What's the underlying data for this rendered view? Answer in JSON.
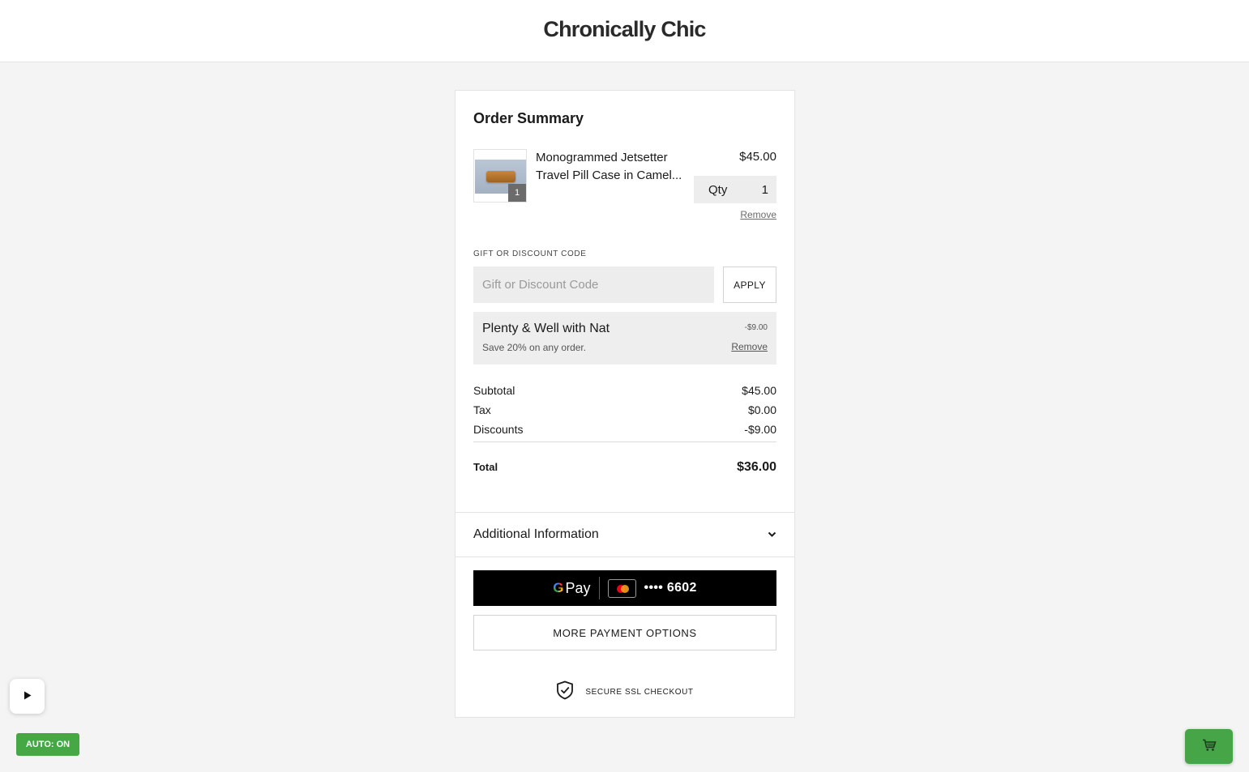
{
  "header": {
    "brand": "Chronically Chic"
  },
  "order_summary": {
    "title": "Order Summary",
    "item": {
      "name_line1": "Monogrammed Jetsetter",
      "name_line2": "Travel Pill Case in Camel...",
      "price": "$45.00",
      "badge_count": "1",
      "qty_label": "Qty",
      "qty_value": "1",
      "remove_label": "Remove"
    },
    "discount": {
      "label": "GIFT OR DISCOUNT CODE",
      "placeholder": "Gift or Discount Code",
      "apply_label": "APPLY"
    },
    "promo": {
      "name": "Plenty & Well with Nat",
      "description": "Save 20% on any order.",
      "amount": "-$9.00",
      "remove_label": "Remove"
    },
    "totals": {
      "subtotal_label": "Subtotal",
      "subtotal_value": "$45.00",
      "tax_label": "Tax",
      "tax_value": "$0.00",
      "discounts_label": "Discounts",
      "discounts_value": "-$9.00",
      "total_label": "Total",
      "total_value": "$36.00"
    },
    "additional_info_label": "Additional Information",
    "gpay": {
      "logo_text": "Pay",
      "card_number": "•••• 6602"
    },
    "more_payment_label": "MORE PAYMENT OPTIONS",
    "secure_label": "SECURE SSL CHECKOUT"
  },
  "overlay": {
    "auto_label": "AUTO: ON"
  },
  "colors": {
    "accent_green": "#45a845",
    "gpay_black": "#000000",
    "page_bg": "#f4f4f4"
  }
}
